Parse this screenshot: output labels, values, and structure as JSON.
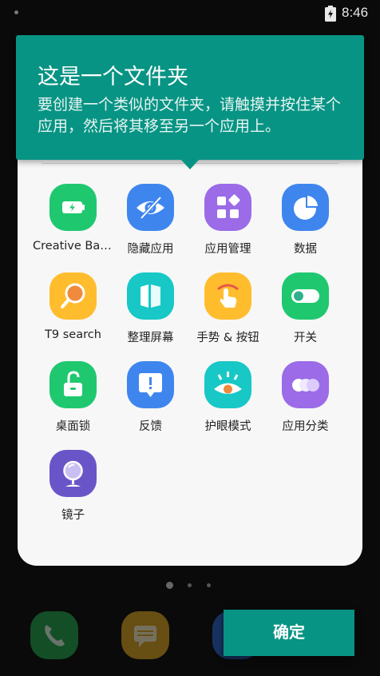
{
  "status_bar": {
    "time": "8:46"
  },
  "tooltip": {
    "title": "这是一个文件夹",
    "body": "要创建一个类似的文件夹，请触摸并按住某个应用，然后将其移至另一个应用上。"
  },
  "folder": {
    "apps": [
      {
        "label": "Creative Batt…",
        "icon": "battery-icon",
        "color": "#1fc86f"
      },
      {
        "label": "隐藏应用",
        "icon": "hidden-eye-icon",
        "color": "#3e86ee"
      },
      {
        "label": "应用管理",
        "icon": "app-manager-icon",
        "color": "#9b6be8"
      },
      {
        "label": "数据",
        "icon": "pie-chart-icon",
        "color": "#3e86ee"
      },
      {
        "label": "T9 search",
        "icon": "magnifier-icon",
        "color": "#ffbd2e"
      },
      {
        "label": "整理屏幕",
        "icon": "organize-screen-icon",
        "color": "#17c8c6"
      },
      {
        "label": "手势 & 按钮",
        "icon": "gesture-hand-icon",
        "color": "#ffbd2e"
      },
      {
        "label": "开关",
        "icon": "toggle-switch-icon",
        "color": "#1fc86f"
      },
      {
        "label": "桌面锁",
        "icon": "unlock-padlock-icon",
        "color": "#1fc86f"
      },
      {
        "label": "反馈",
        "icon": "feedback-bubble-icon",
        "color": "#3e86ee"
      },
      {
        "label": "护眼模式",
        "icon": "eye-care-icon",
        "color": "#17c8c6"
      },
      {
        "label": "应用分类",
        "icon": "app-category-icon",
        "color": "#9b6be8"
      },
      {
        "label": "镜子",
        "icon": "mirror-icon",
        "color": "#6a55c8"
      }
    ]
  },
  "confirm_button": {
    "label": "确定"
  }
}
